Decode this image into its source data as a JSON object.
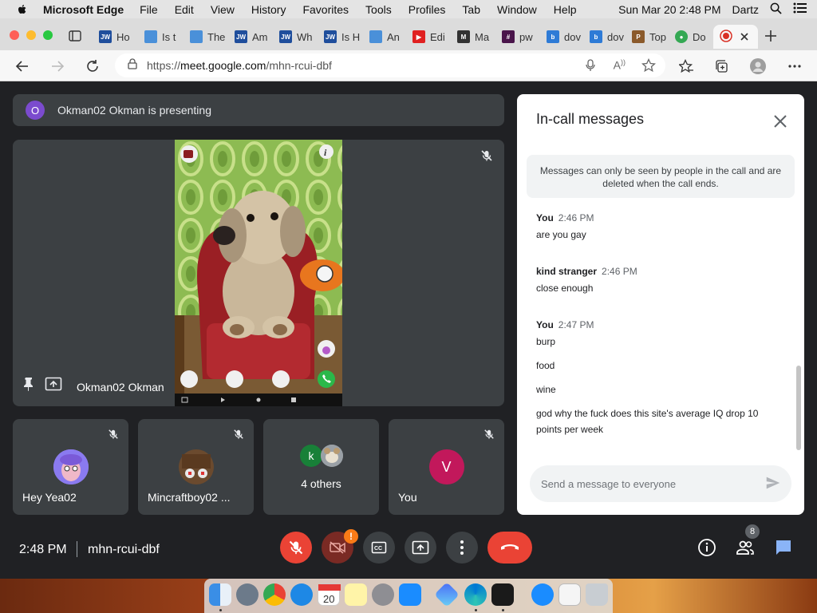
{
  "menubar": {
    "app_name": "Microsoft Edge",
    "items": [
      "File",
      "Edit",
      "View",
      "History",
      "Favorites",
      "Tools",
      "Profiles",
      "Tab",
      "Window",
      "Help"
    ],
    "clock": "Sun Mar 20  2:48 PM",
    "user": "Dartz"
  },
  "tabs": [
    {
      "label": "Ho",
      "fav": "JW",
      "color": "#1f4e9c"
    },
    {
      "label": "Is t",
      "fav": "",
      "color": "#4a90d9"
    },
    {
      "label": "The",
      "fav": "",
      "color": "#4a90d9"
    },
    {
      "label": "Am",
      "fav": "JW",
      "color": "#1f4e9c"
    },
    {
      "label": "Wh",
      "fav": "JW",
      "color": "#1f4e9c"
    },
    {
      "label": "Is H",
      "fav": "JW",
      "color": "#1f4e9c"
    },
    {
      "label": "An",
      "fav": "",
      "color": "#4a90d9"
    },
    {
      "label": "Edi",
      "fav": "▶",
      "color": "#e02020"
    },
    {
      "label": "Ma",
      "fav": "M",
      "color": "#333333"
    },
    {
      "label": "pw",
      "fav": "#",
      "color": "#4a154b"
    },
    {
      "label": "dov",
      "fav": "b",
      "color": "#2e7bd6"
    },
    {
      "label": "dov",
      "fav": "b",
      "color": "#2e7bd6"
    },
    {
      "label": "Top",
      "fav": "P",
      "color": "#8b5a2b"
    },
    {
      "label": "Do",
      "fav": "●",
      "color": "#34a853"
    }
  ],
  "address": {
    "scheme": "https://",
    "host": "meet.google.com",
    "path": "/mhn-rcui-dbf"
  },
  "meet": {
    "presenting_initial": "O",
    "presenting_text": "Okman02 Okman is presenting",
    "main_tile_name": "Okman02 Okman",
    "tiles": [
      {
        "name": "Hey Yea02"
      },
      {
        "name": "Mincraftboy02 ..."
      },
      {
        "name": "4 others",
        "initial": "k"
      },
      {
        "name": "You",
        "initial": "V"
      }
    ]
  },
  "chat": {
    "title": "In-call messages",
    "notice": "Messages can only be seen by people in the call and are deleted when the call ends.",
    "messages": [
      {
        "sender": "You",
        "time": "2:46 PM",
        "lines": [
          "are you gay"
        ]
      },
      {
        "sender": "kind stranger",
        "time": "2:46 PM",
        "lines": [
          "close enough"
        ]
      },
      {
        "sender": "You",
        "time": "2:47 PM",
        "lines": [
          "burp",
          "food",
          "wine",
          "god why the fuck does this site's average IQ drop 10 points per week"
        ]
      }
    ],
    "input_placeholder": "Send a message to everyone"
  },
  "bottombar": {
    "time": "2:48 PM",
    "meeting_code": "mhn-rcui-dbf",
    "participant_count": "8",
    "camera_warning": "!"
  },
  "colors": {
    "meet_bg": "#202124",
    "tile_bg": "#3c4043",
    "hangup": "#ea4335",
    "mic_off": "#ea4335",
    "chat_active": "#8ab4f8"
  }
}
